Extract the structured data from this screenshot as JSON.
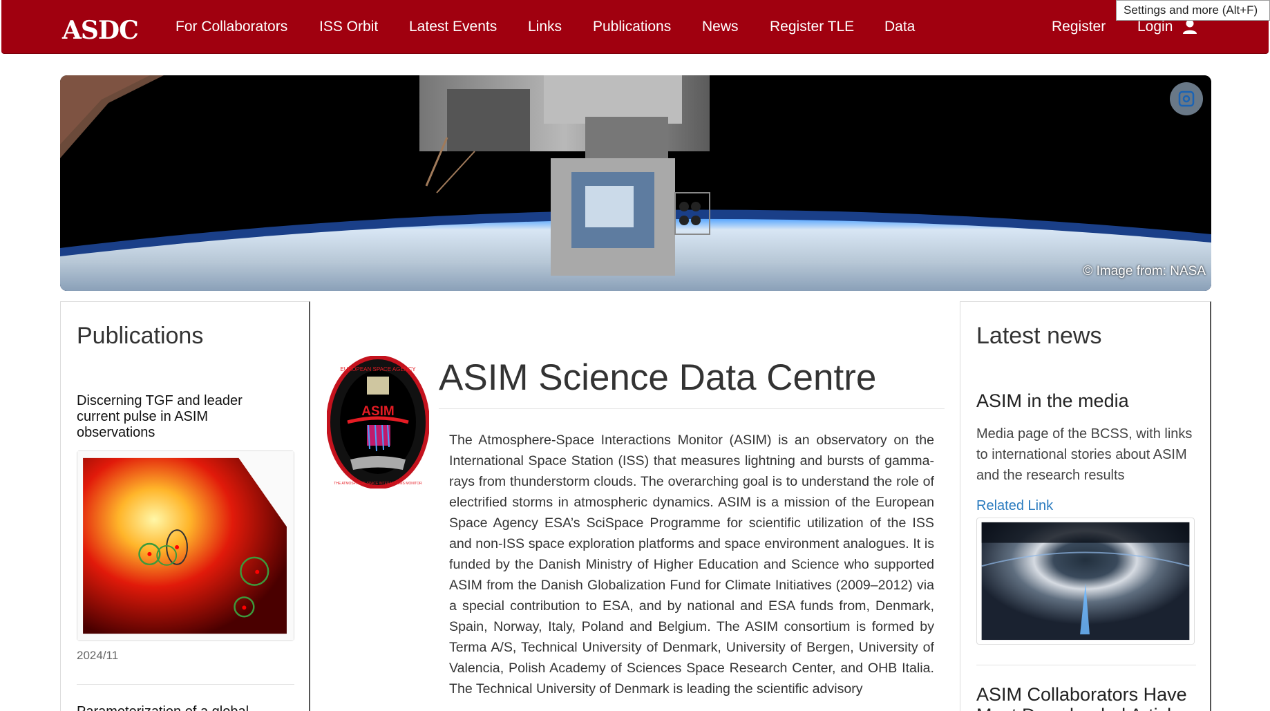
{
  "navbar": {
    "logo_text": "ASDC",
    "items": [
      "For Collaborators",
      "ISS Orbit",
      "Latest Events",
      "Links",
      "Publications",
      "News",
      "Register TLE",
      "Data"
    ],
    "register": "Register",
    "login": "Login",
    "login_icon": "user-icon"
  },
  "tooltip": "Settings and more (Alt+F)",
  "hero": {
    "caption": "© Image from: NASA",
    "action_icon": "visual-search-icon"
  },
  "publications": {
    "heading": "Publications",
    "items": [
      {
        "title": "Discerning TGF and leader current pulse in ASIM observations",
        "date": "2024/11"
      },
      {
        "title": "Parameterization of a global..."
      }
    ]
  },
  "main": {
    "logo_texts": {
      "top": "EUROPEAN SPACE AGENCY",
      "center": "ASIM",
      "bottom": "THE ATMOSPHERE-SPACE INTERACTIONS MONITOR"
    },
    "title": "ASIM Science Data Centre",
    "intro": "The Atmosphere-Space Interactions Monitor (ASIM) is an observatory on the International Space Station (ISS) that measures lightning and bursts of gamma-rays from thunderstorm clouds. The overarching goal is to understand the role of electrified storms in atmospheric dynamics. ASIM is a mission of the European Space Agency ESA’s SciSpace Programme for scientific utilization of the ISS and non-ISS space exploration platforms and space environment analogues. It is funded by the Danish Ministry of Higher Education and Science who supported ASIM from the Danish Globalization Fund for Climate Initiatives (2009–2012) via a special contribution to ESA, and by national and ESA funds from, Denmark, Spain, Norway, Italy, Poland and Belgium. The ASIM consortium is formed by Terma A/S, Technical University of Denmark, University of Bergen, University of Valencia, Polish Academy of Sciences Space Research Center, and OHB Italia. The Technical University of Denmark is leading the scientific advisory"
  },
  "latest_news": {
    "heading": "Latest news",
    "items": [
      {
        "title": "ASIM in the media",
        "description": "Media page of the BCSS, with links to international stories about ASIM and the research results",
        "link": "Related Link"
      },
      {
        "title": "ASIM Collaborators Have Most Downloaded Article"
      }
    ]
  },
  "colors": {
    "navbar_bg": "#a0000f",
    "link": "#2a7bbf",
    "text": "#333333"
  }
}
